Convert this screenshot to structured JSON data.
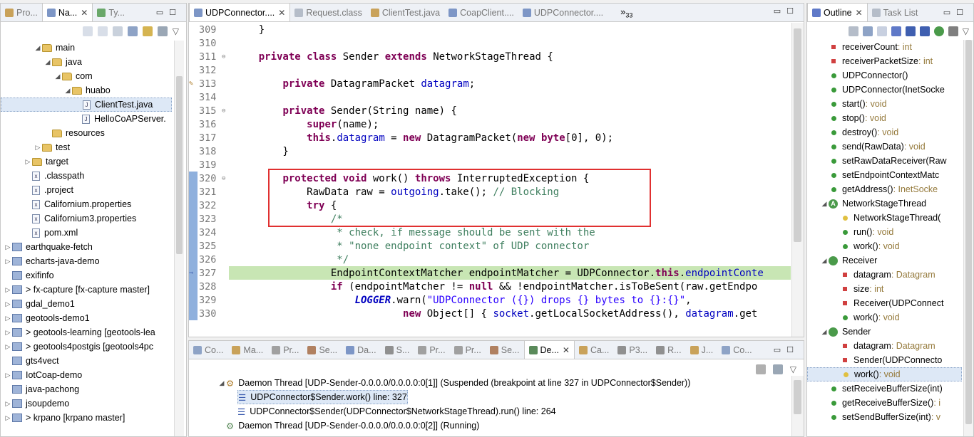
{
  "navigator": {
    "tabs": [
      {
        "label": "Pro..."
      },
      {
        "label": "Na...",
        "active": true
      },
      {
        "label": "Ty..."
      }
    ],
    "tree": [
      {
        "indent": 3,
        "arrow": "◢",
        "kind": "folder",
        "label": "main"
      },
      {
        "indent": 4,
        "arrow": "◢",
        "kind": "folder",
        "label": "java"
      },
      {
        "indent": 5,
        "arrow": "◢",
        "kind": "folder",
        "label": "com"
      },
      {
        "indent": 6,
        "arrow": "◢",
        "kind": "folder",
        "label": "huabo"
      },
      {
        "indent": 7,
        "arrow": "",
        "kind": "java",
        "label": "ClientTest.java",
        "selected": true
      },
      {
        "indent": 7,
        "arrow": "",
        "kind": "java",
        "label": "HelloCoAPServer."
      },
      {
        "indent": 4,
        "arrow": "",
        "kind": "folder",
        "label": "resources"
      },
      {
        "indent": 3,
        "arrow": "▷",
        "kind": "folder",
        "label": "test"
      },
      {
        "indent": 2,
        "arrow": "▷",
        "kind": "folder",
        "label": "target"
      },
      {
        "indent": 2,
        "arrow": "",
        "kind": "file",
        "label": ".classpath"
      },
      {
        "indent": 2,
        "arrow": "",
        "kind": "file",
        "label": ".project"
      },
      {
        "indent": 2,
        "arrow": "",
        "kind": "file",
        "label": "Californium.properties"
      },
      {
        "indent": 2,
        "arrow": "",
        "kind": "file",
        "label": "Californium3.properties"
      },
      {
        "indent": 2,
        "arrow": "",
        "kind": "file",
        "label": "pom.xml"
      },
      {
        "indent": 0,
        "arrow": "▷",
        "kind": "project",
        "label": "earthquake-fetch"
      },
      {
        "indent": 0,
        "arrow": "▷",
        "kind": "project",
        "label": "echarts-java-demo"
      },
      {
        "indent": 0,
        "arrow": "",
        "kind": "project",
        "label": "exifinfo"
      },
      {
        "indent": 0,
        "arrow": "▷",
        "kind": "project",
        "label": "> fx-capture [fx-capture master]"
      },
      {
        "indent": 0,
        "arrow": "▷",
        "kind": "project",
        "label": "gdal_demo1"
      },
      {
        "indent": 0,
        "arrow": "▷",
        "kind": "project",
        "label": "geotools-demo1"
      },
      {
        "indent": 0,
        "arrow": "▷",
        "kind": "project",
        "label": "> geotools-learning [geotools-lea"
      },
      {
        "indent": 0,
        "arrow": "▷",
        "kind": "project",
        "label": "> geotools4postgis [geotools4pc"
      },
      {
        "indent": 0,
        "arrow": "",
        "kind": "project",
        "label": "gts4vect"
      },
      {
        "indent": 0,
        "arrow": "▷",
        "kind": "project",
        "label": "IotCoap-demo"
      },
      {
        "indent": 0,
        "arrow": "",
        "kind": "project",
        "label": "java-pachong"
      },
      {
        "indent": 0,
        "arrow": "▷",
        "kind": "project",
        "label": "jsoupdemo"
      },
      {
        "indent": 0,
        "arrow": "▷",
        "kind": "project",
        "label": "> krpano [krpano master]"
      }
    ]
  },
  "editor": {
    "tabs": [
      {
        "label": "UDPConnector....",
        "active": true
      },
      {
        "label": "Request.class"
      },
      {
        "label": "ClientTest.java"
      },
      {
        "label": "CoapClient...."
      },
      {
        "label": "UDPConnector...."
      }
    ],
    "overflow_label": "»",
    "overflow_count": "33",
    "lines": [
      {
        "n": "309",
        "html": "    }"
      },
      {
        "n": "310",
        "html": ""
      },
      {
        "n": "311",
        "fold": true,
        "html": "    <span class='kw'>private</span> <span class='kw'>class</span> Sender <span class='kw'>extends</span> NetworkStageThread {"
      },
      {
        "n": "312",
        "html": ""
      },
      {
        "n": "313",
        "html": "        <span class='kw'>private</span> DatagramPacket <span class='fld'>datagram</span>;"
      },
      {
        "n": "314",
        "html": ""
      },
      {
        "n": "315",
        "fold": true,
        "html": "        <span class='kw'>private</span> Sender(String name) {"
      },
      {
        "n": "316",
        "html": "            <span class='kw'>super</span>(name);"
      },
      {
        "n": "317",
        "html": "            <span class='kw'>this</span>.<span class='fld'>datagram</span> = <span class='kw'>new</span> DatagramPacket(<span class='kw'>new</span> <span class='kw'>byte</span>[0], 0);"
      },
      {
        "n": "318",
        "html": "        }"
      },
      {
        "n": "319",
        "html": ""
      },
      {
        "n": "320",
        "fold": true,
        "html": "        <span class='kw'>protected</span> <span class='kw'>void</span> work() <span class='kw'>throws</span> InterruptedException {"
      },
      {
        "n": "321",
        "html": "            RawData raw = <span class='fld'>outgoing</span>.take(); <span class='cm'>// Blocking</span>"
      },
      {
        "n": "322",
        "html": "            <span class='kw'>try</span> {"
      },
      {
        "n": "323",
        "html": "                <span class='cm'>/*</span>"
      },
      {
        "n": "324",
        "html": "                <span class='cm'> * check, if message should be sent with the</span>"
      },
      {
        "n": "325",
        "html": "                <span class='cm'> * \"none endpoint context\" of UDP connector</span>"
      },
      {
        "n": "326",
        "html": "                <span class='cm'> */</span>"
      },
      {
        "n": "327",
        "current": true,
        "html": "                EndpointContextMatcher endpointMatcher = UDPConnector.<span class='kw'>this</span>.<span class='fld'>endpointConte</span>"
      },
      {
        "n": "328",
        "html": "                <span class='kw'>if</span> (endpointMatcher != <span class='kw'>null</span> &amp;&amp; !endpointMatcher.isToBeSent(raw.getEndpo"
      },
      {
        "n": "329",
        "html": "                    <span class='sf'>LOGGER</span>.warn(<span class='str'>\"UDPConnector ({}) drops {} bytes to {}:{}\"</span>,"
      },
      {
        "n": "330",
        "html": "                            <span class='kw'>new</span> Object[] { <span class='fld'>socket</span>.getLocalSocketAddress(), <span class='fld'>datagram</span>.get"
      }
    ]
  },
  "outline": {
    "tabs": [
      {
        "label": "Outline",
        "active": true
      },
      {
        "label": "Task List"
      }
    ],
    "items": [
      {
        "indent": 0,
        "kind": "field-private",
        "name": "receiverCount",
        "type": " : int"
      },
      {
        "indent": 0,
        "kind": "field-private",
        "name": "receiverPacketSize",
        "type": " : int"
      },
      {
        "indent": 0,
        "kind": "ctor",
        "name": "UDPConnector()",
        "type": ""
      },
      {
        "indent": 0,
        "kind": "ctor",
        "name": "UDPConnector(InetSocke",
        "type": ""
      },
      {
        "indent": 0,
        "kind": "method",
        "name": "start()",
        "type": " : void"
      },
      {
        "indent": 0,
        "kind": "method",
        "name": "stop()",
        "type": " : void"
      },
      {
        "indent": 0,
        "kind": "method",
        "name": "destroy()",
        "type": " : void"
      },
      {
        "indent": 0,
        "kind": "method",
        "name": "send(RawData)",
        "type": " : void"
      },
      {
        "indent": 0,
        "kind": "method",
        "name": "setRawDataReceiver(Raw",
        "type": ""
      },
      {
        "indent": 0,
        "kind": "method",
        "name": "setEndpointContextMatc",
        "type": ""
      },
      {
        "indent": 0,
        "kind": "method",
        "name": "getAddress()",
        "type": " : InetSocke"
      },
      {
        "indent": 0,
        "kind": "class",
        "arrow": "◢",
        "badge": "A",
        "name": "NetworkStageThread",
        "type": ""
      },
      {
        "indent": 1,
        "kind": "ctor-pkg",
        "name": "NetworkStageThread(",
        "type": ""
      },
      {
        "indent": 1,
        "kind": "method",
        "name": "run()",
        "type": " : void"
      },
      {
        "indent": 1,
        "kind": "method",
        "name": "work()",
        "type": " : void"
      },
      {
        "indent": 0,
        "kind": "class",
        "arrow": "◢",
        "badge": "",
        "name": "Receiver",
        "type": ""
      },
      {
        "indent": 1,
        "kind": "field-private",
        "name": "datagram",
        "type": " : Datagram"
      },
      {
        "indent": 1,
        "kind": "field-private",
        "name": "size",
        "type": " : int"
      },
      {
        "indent": 1,
        "kind": "ctor-private",
        "name": "Receiver(UDPConnect",
        "type": ""
      },
      {
        "indent": 1,
        "kind": "method",
        "name": "work()",
        "type": " : void"
      },
      {
        "indent": 0,
        "kind": "class",
        "arrow": "◢",
        "badge": "",
        "name": "Sender",
        "type": ""
      },
      {
        "indent": 1,
        "kind": "field-private",
        "name": "datagram",
        "type": " : Datagram"
      },
      {
        "indent": 1,
        "kind": "ctor-private",
        "name": "Sender(UDPConnecto",
        "type": ""
      },
      {
        "indent": 1,
        "kind": "method-pkg",
        "name": "work()",
        "type": " : void",
        "selected": true
      },
      {
        "indent": 0,
        "kind": "method",
        "name": "setReceiveBufferSize(int)",
        "type": ""
      },
      {
        "indent": 0,
        "kind": "method",
        "name": "getReceiveBufferSize()",
        "type": " : i"
      },
      {
        "indent": 0,
        "kind": "method",
        "name": "setSendBufferSize(int)",
        "type": " : v"
      }
    ]
  },
  "bottom": {
    "tabs": [
      {
        "label": "Co..."
      },
      {
        "label": "Ma..."
      },
      {
        "label": "Pr..."
      },
      {
        "label": "Se..."
      },
      {
        "label": "Da..."
      },
      {
        "label": "S..."
      },
      {
        "label": "Pr..."
      },
      {
        "label": "Pr..."
      },
      {
        "label": "Se..."
      },
      {
        "label": "De...",
        "active": true
      },
      {
        "label": "Ca..."
      },
      {
        "label": "P3..."
      },
      {
        "label": "R..."
      },
      {
        "label": "J..."
      },
      {
        "label": "Co..."
      }
    ],
    "debug": [
      {
        "indent": 0,
        "kind": "thread",
        "arrow": "◢",
        "label": "Daemon Thread [UDP-Sender-0.0.0.0/0.0.0.0:0[1]] (Suspended (breakpoint at line 327 in UDPConnector$Sender))"
      },
      {
        "indent": 1,
        "kind": "frame",
        "label": "UDPConnector$Sender.work() line: 327",
        "selected": true
      },
      {
        "indent": 1,
        "kind": "frame",
        "label": "UDPConnector$Sender(UDPConnector$NetworkStageThread).run() line: 264"
      },
      {
        "indent": 0,
        "kind": "thread-run",
        "arrow": "",
        "label": "Daemon Thread [UDP-Sender-0.0.0.0/0.0.0.0:0[2]] (Running)"
      }
    ]
  },
  "colors": {
    "selection": "#dde8f6",
    "current_line": "#c8e6b4",
    "highlight_box": "#e03030",
    "keyword": "#7f0055",
    "field": "#0000c0",
    "comment": "#3f7f5f",
    "string": "#2a00ff"
  }
}
